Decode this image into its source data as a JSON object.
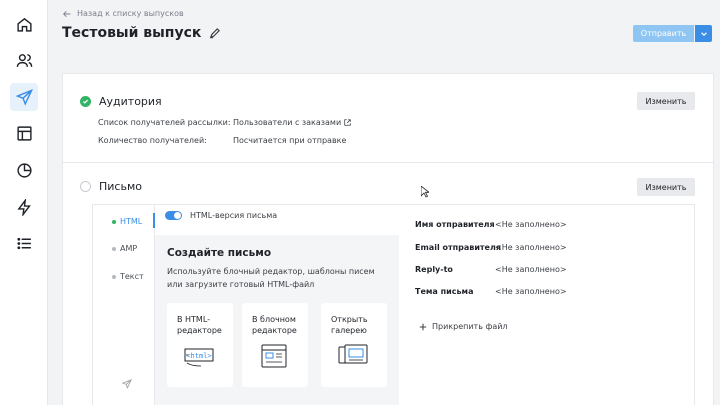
{
  "back_link": "Назад к списку выпусков",
  "page_title": "Тестовый выпуск",
  "send": {
    "label": "Отправить"
  },
  "audience": {
    "title": "Аудитория",
    "change_label": "Изменить",
    "rows": [
      {
        "label": "Список получателей рассылки:",
        "value": "Пользователи с заказами"
      },
      {
        "label": "Количество получателей:",
        "value": "Посчитается при отправке"
      }
    ]
  },
  "letter": {
    "title": "Письмо",
    "change_label": "Изменить",
    "tabs": [
      "HTML",
      "AMP",
      "Текст"
    ],
    "toggle_label": "HTML-версия письма",
    "create": {
      "title": "Создайте письмо",
      "description": "Используйте блочный редактор, шаблоны писем или загрузите готовый HTML-файл",
      "options": [
        {
          "label": "В HTML-редакторе",
          "icon": "html-editor-icon"
        },
        {
          "label": "В блочном редакторе",
          "icon": "block-editor-icon"
        },
        {
          "label": "Открыть галерею",
          "icon": "gallery-icon"
        }
      ]
    },
    "fields": [
      {
        "label": "Имя отправителя",
        "value": "<Не заполнено>"
      },
      {
        "label": "Email отправителя",
        "value": "<Не заполнено>"
      },
      {
        "label": "Reply-to",
        "value": "<Не заполнено>"
      },
      {
        "label": "Тема письма",
        "value": "<Не заполнено>"
      }
    ],
    "attach_label": "Прикрепить файл"
  },
  "colors": {
    "accent": "#3a8ee6",
    "success": "#33b366",
    "send_disabled": "#8ec5f3"
  }
}
